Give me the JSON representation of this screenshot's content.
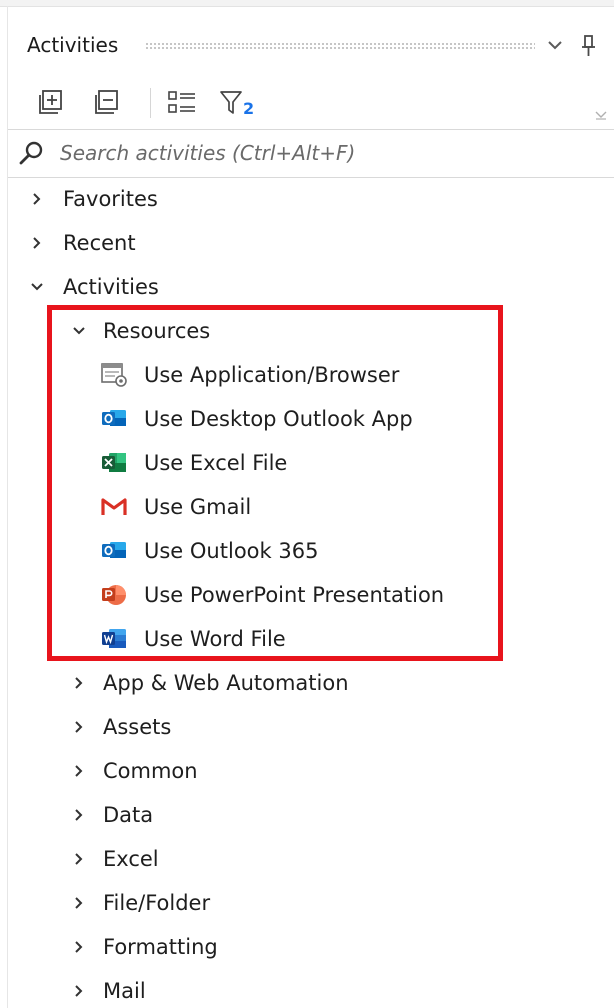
{
  "panel": {
    "title": "Activities",
    "colors": {
      "highlight": "#e8141c",
      "filter_badge": "#1a73e8",
      "border": "#d9d9d9"
    }
  },
  "toolbar": {
    "expand_all_icon": "expand-all-icon",
    "collapse_all_icon": "collapse-all-icon",
    "view_options_icon": "list-view-icon",
    "filter_icon": "filter-icon",
    "filter_badge": "2"
  },
  "search": {
    "placeholder": "Search activities (Ctrl+Alt+F)",
    "value": ""
  },
  "tree": {
    "top_level": [
      {
        "label": "Favorites",
        "expanded": false
      },
      {
        "label": "Recent",
        "expanded": false
      },
      {
        "label": "Activities",
        "expanded": true
      }
    ],
    "resources": {
      "label": "Resources",
      "expanded": true,
      "items": [
        {
          "label": "Use Application/Browser",
          "icon": "application-browser-icon"
        },
        {
          "label": "Use Desktop Outlook App",
          "icon": "outlook-icon"
        },
        {
          "label": "Use Excel File",
          "icon": "excel-icon"
        },
        {
          "label": "Use Gmail",
          "icon": "gmail-icon"
        },
        {
          "label": "Use Outlook 365",
          "icon": "outlook-365-icon"
        },
        {
          "label": "Use PowerPoint Presentation",
          "icon": "powerpoint-icon"
        },
        {
          "label": "Use Word File",
          "icon": "word-icon"
        }
      ]
    },
    "categories": [
      {
        "label": "App & Web Automation",
        "expanded": false
      },
      {
        "label": "Assets",
        "expanded": false
      },
      {
        "label": "Common",
        "expanded": false
      },
      {
        "label": "Data",
        "expanded": false
      },
      {
        "label": "Excel",
        "expanded": false
      },
      {
        "label": "File/Folder",
        "expanded": false
      },
      {
        "label": "Formatting",
        "expanded": false
      },
      {
        "label": "Mail",
        "expanded": false
      }
    ]
  }
}
